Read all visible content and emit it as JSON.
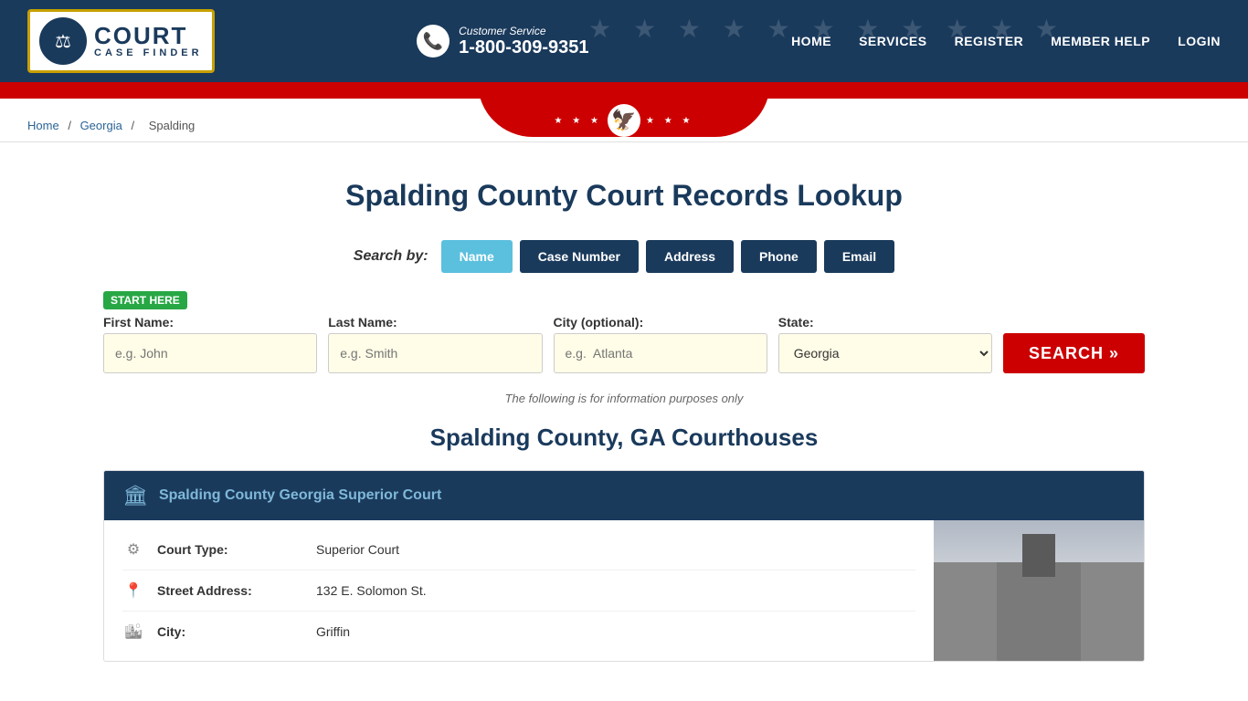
{
  "header": {
    "logo_court": "COURT",
    "logo_case_finder": "CASE FINDER",
    "cs_label": "Customer Service",
    "cs_phone": "1-800-309-9351",
    "nav": [
      {
        "label": "HOME",
        "href": "#"
      },
      {
        "label": "SERVICES",
        "href": "#"
      },
      {
        "label": "REGISTER",
        "href": "#"
      },
      {
        "label": "MEMBER HELP",
        "href": "#"
      },
      {
        "label": "LOGIN",
        "href": "#"
      }
    ]
  },
  "breadcrumb": {
    "home": "Home",
    "sep1": "/",
    "georgia": "Georgia",
    "sep2": "/",
    "current": "Spalding"
  },
  "main": {
    "page_title": "Spalding County Court Records Lookup",
    "search_by_label": "Search by:",
    "tabs": [
      {
        "label": "Name",
        "active": true
      },
      {
        "label": "Case Number",
        "active": false
      },
      {
        "label": "Address",
        "active": false
      },
      {
        "label": "Phone",
        "active": false
      },
      {
        "label": "Email",
        "active": false
      }
    ],
    "start_here": "START HERE",
    "form": {
      "first_name_label": "First Name:",
      "first_name_placeholder": "e.g. John",
      "last_name_label": "Last Name:",
      "last_name_placeholder": "e.g. Smith",
      "city_label": "City (optional):",
      "city_placeholder": "e.g.  Atlanta",
      "state_label": "State:",
      "state_value": "Georgia",
      "search_btn": "SEARCH »"
    },
    "info_note": "The following is for information purposes only",
    "courthouses_title": "Spalding County, GA Courthouses",
    "court_card": {
      "header_title": "Spalding County Georgia Superior Court",
      "rows": [
        {
          "icon": "⚙",
          "label": "Court Type:",
          "value": "Superior Court"
        },
        {
          "icon": "📍",
          "label": "Street Address:",
          "value": "132 E. Solomon St."
        },
        {
          "icon": "🏛",
          "label": "City:",
          "value": "Griffin"
        }
      ]
    }
  }
}
